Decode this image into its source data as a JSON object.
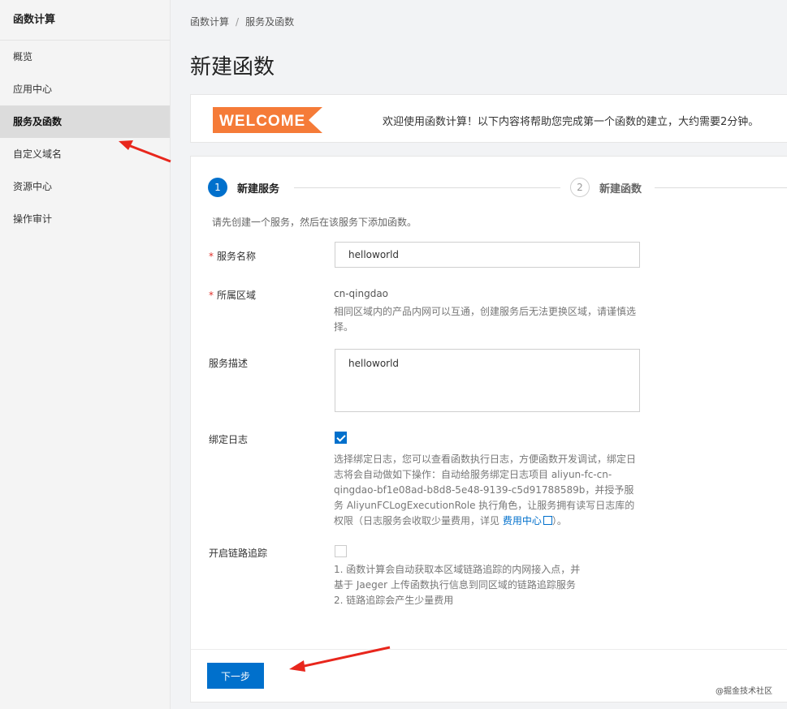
{
  "sidebar": {
    "title": "函数计算",
    "items": [
      {
        "label": "概览"
      },
      {
        "label": "应用中心"
      },
      {
        "label": "服务及函数"
      },
      {
        "label": "自定义域名"
      },
      {
        "label": "资源中心"
      },
      {
        "label": "操作审计"
      }
    ]
  },
  "breadcrumb": {
    "root": "函数计算",
    "separator": "/",
    "current": "服务及函数"
  },
  "page_title": "新建函数",
  "welcome": {
    "banner_text": "WELCOME",
    "message": "欢迎使用函数计算！以下内容将帮助您完成第一个函数的建立，大约需要2分钟。"
  },
  "steps": [
    {
      "number": "1",
      "label": "新建服务"
    },
    {
      "number": "2",
      "label": "新建函数"
    }
  ],
  "form": {
    "intro": "请先创建一个服务，然后在该服务下添加函数。",
    "required_mark": "*",
    "service_name": {
      "label": "服务名称",
      "value": "helloworld"
    },
    "region": {
      "label": "所属区域",
      "value": "cn-qingdao",
      "help": "相同区域内的产品内网可以互通，创建服务后无法更换区域，请谨慎选择。"
    },
    "description": {
      "label": "服务描述",
      "value": "helloworld"
    },
    "bind_log": {
      "label": "绑定日志",
      "checked": true,
      "help": "选择绑定日志，您可以查看函数执行日志，方便函数开发调试，绑定日志将会自动做如下操作：自动给服务绑定日志项目 aliyun-fc-cn-qingdao-bf1e08ad-b8d8-5e48-9139-c5d91788589b，并授予服务 AliyunFCLogExecutionRole 执行角色，让服务拥有读写日志库的权限（日志服务会收取少量费用，详见 ",
      "link": "费用中心",
      "help_suffix": "）。"
    },
    "tracing": {
      "label": "开启链路追踪",
      "checked": false,
      "help_line1": "1. 函数计算会自动获取本区域链路追踪的内网接入点，并",
      "help_line2": "基于 Jaeger 上传函数执行信息到同区域的链路追踪服务",
      "help_line3": "2. 链路追踪会产生少量费用"
    }
  },
  "footer": {
    "next_label": "下一步"
  },
  "watermark": "@掘金技术社区",
  "colors": {
    "primary": "#0070cc",
    "annotation_arrow": "#e8261c",
    "welcome_orange": "#f57b38"
  }
}
